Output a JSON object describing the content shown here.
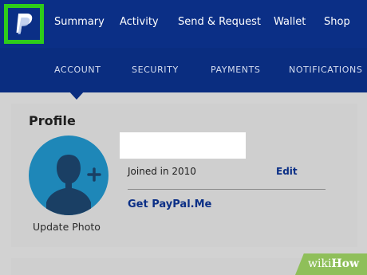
{
  "app": {
    "logo_icon": "paypal-logo-icon",
    "highlight_color": "#2ecc1a",
    "brand_color": "#0b2f86"
  },
  "nav": {
    "items": [
      "Summary",
      "Activity",
      "Send & Request",
      "Wallet",
      "Shop"
    ]
  },
  "subnav": {
    "items": [
      "ACCOUNT",
      "SECURITY",
      "PAYMENTS",
      "NOTIFICATIONS"
    ],
    "active": "ACCOUNT"
  },
  "profile": {
    "title": "Profile",
    "avatar_icon": "user-silhouette-icon",
    "add_photo_icon": "plus-icon",
    "update_photo_label": "Update Photo",
    "joined_text": "Joined in 2010",
    "edit_label": "Edit",
    "paypalme_label": "Get PayPal.Me"
  },
  "watermark": {
    "wiki": "wiki",
    "how": "How"
  }
}
